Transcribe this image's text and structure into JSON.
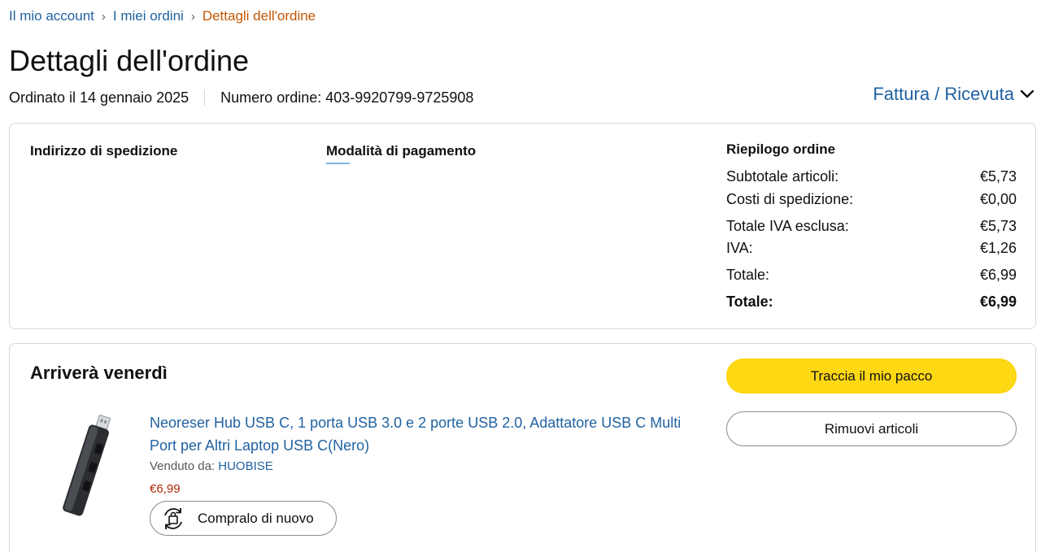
{
  "breadcrumb": {
    "account": "Il mio account",
    "orders": "I miei ordini",
    "current": "Dettagli dell'ordine",
    "separator": "›"
  },
  "page_title": "Dettagli dell'ordine",
  "order_meta": {
    "ordered_on": "Ordinato il 14 gennaio 2025",
    "order_number": "Numero ordine: 403-9920799-9725908"
  },
  "invoice_link": "Fattura / Ricevuta",
  "shipping": {
    "title": "Indirizzo di spedizione"
  },
  "payment": {
    "title": "Modalità di pagamento"
  },
  "summary": {
    "title": "Riepilogo ordine",
    "rows": [
      {
        "label": "Subtotale articoli:",
        "value": "€5,73"
      },
      {
        "label": "Costi di spedizione:",
        "value": "€0,00"
      },
      {
        "label": "Totale IVA esclusa:",
        "value": "€5,73"
      },
      {
        "label": "IVA:",
        "value": "€1,26"
      },
      {
        "label": "Totale:",
        "value": "€6,99"
      },
      {
        "label": "Totale:",
        "value": "€6,99"
      }
    ]
  },
  "shipment": {
    "status": "Arriverà venerdì",
    "product_title": "Neoreser Hub USB C, 1 porta USB 3.0 e 2 porte USB 2.0, Adattatore USB C Multi Port per Altri Laptop USB C(Nero)",
    "sold_by_label": "Venduto da:",
    "seller": "HUOBISE",
    "price": "€6,99",
    "buy_again": "Compralo di nuovo",
    "track_button": "Traccia il mio pacco",
    "remove_button": "Rimuovi articoli"
  },
  "colors": {
    "link": "#2162a1",
    "breadcrumb_current": "#c45500",
    "price": "#b12704",
    "track_button": "#ffd814"
  },
  "icons": {
    "breadcrumb_separator": "chevron-right-icon",
    "invoice_dropdown": "chevron-down-icon",
    "buy_again": "buy-again-cycle-icon"
  }
}
